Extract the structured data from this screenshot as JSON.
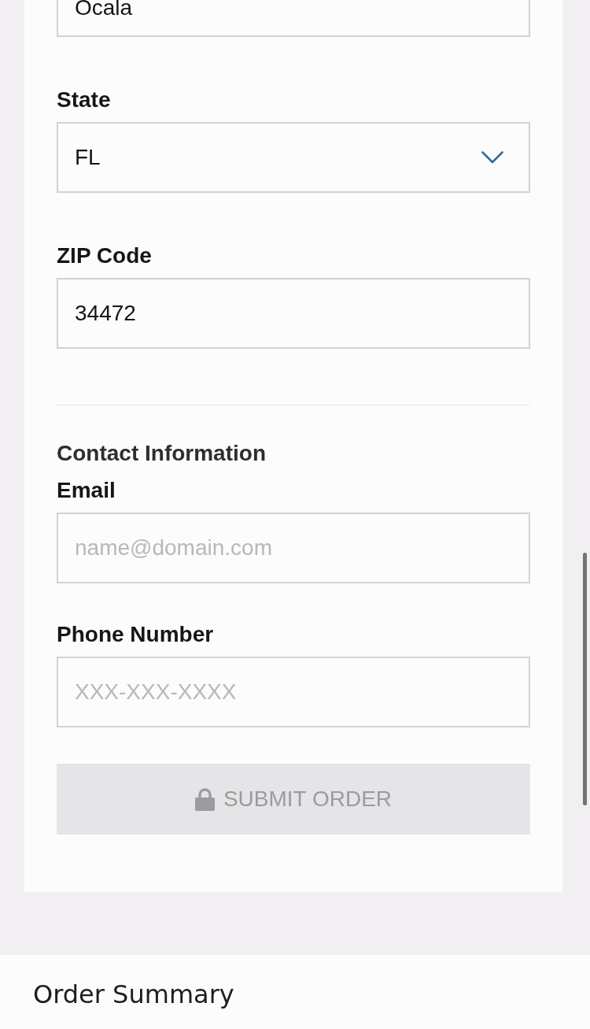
{
  "address_fields": [
    {
      "kind": "text",
      "value": "Ocala"
    },
    {
      "kind": "select",
      "label": "State",
      "value": "FL"
    },
    {
      "kind": "text",
      "label": "ZIP Code",
      "value": "34472"
    }
  ],
  "contact": {
    "heading": "Contact Information",
    "fields": [
      {
        "kind": "text",
        "label": "Email",
        "placeholder": "name@domain.com"
      },
      {
        "kind": "text",
        "label": "Phone Number",
        "placeholder": "XXX-XXX-XXXX"
      }
    ]
  },
  "submit_button": {
    "label": "SUBMIT ORDER",
    "disabled": true
  },
  "order_summary": {
    "title": "Order Summary"
  }
}
